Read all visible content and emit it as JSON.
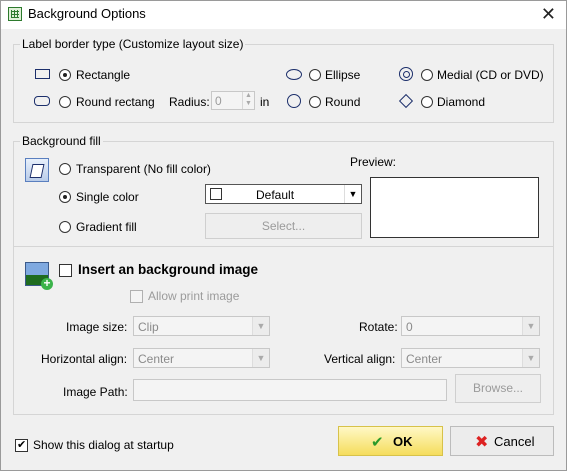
{
  "window": {
    "title": "Background Options"
  },
  "border_group": {
    "label": "Label border type (Customize layout size)",
    "rectangle": "Rectangle",
    "round_rect": "Round rectang",
    "radius_label": "Radius:",
    "radius_value": "0",
    "radius_unit": "in",
    "ellipse": "Ellipse",
    "round": "Round",
    "medial": "Medial (CD or DVD)",
    "diamond": "Diamond",
    "selected": "Rectangle"
  },
  "fill_group": {
    "label": "Background fill",
    "transparent": "Transparent (No fill color)",
    "single_color": "Single color",
    "gradient_fill": "Gradient fill",
    "selected": "Single color",
    "color_value": "Default",
    "select_button": "Select...",
    "preview_label": "Preview:"
  },
  "image_group": {
    "insert_label": "Insert an background image",
    "insert_checked": false,
    "allow_print": "Allow print image",
    "image_size_label": "Image size:",
    "image_size_value": "Clip",
    "rotate_label": "Rotate:",
    "rotate_value": "0",
    "h_align_label": "Horizontal align:",
    "h_align_value": "Center",
    "v_align_label": "Vertical align:",
    "v_align_value": "Center",
    "path_label": "Image Path:",
    "path_value": "",
    "browse_button": "Browse..."
  },
  "footer": {
    "startup_label": "Show this dialog at startup",
    "startup_checked": true,
    "ok": "OK",
    "cancel": "Cancel"
  }
}
